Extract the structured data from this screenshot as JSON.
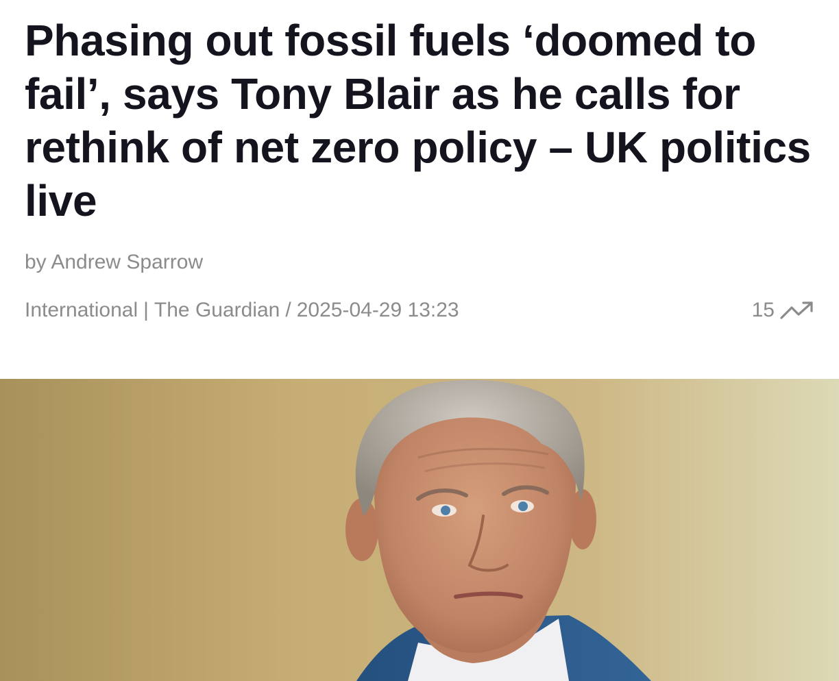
{
  "article": {
    "headline": "Phasing out fossil fuels ‘doomed to fail’, says Tony Blair as he calls for rethink of net zero policy – UK politics live",
    "byline": "by Andrew Sparrow",
    "section": "International",
    "separator": "|",
    "source": "The Guardian",
    "slash": "/",
    "timestamp": "2025-04-29 13:23",
    "trend_count": "15",
    "trend_icon": "trending-up-icon"
  },
  "hero_image": {
    "description_icon": "portrait-photo",
    "colors": {
      "background_left": "#a88f55",
      "background_mid": "#c9b27a",
      "background_right": "#d9d6b2",
      "skin": "#c48a68",
      "hair": "#b9b3aa",
      "jacket": "#2c5a8a",
      "shirt": "#f2f2f4"
    }
  },
  "colors": {
    "headline": "#14141f",
    "meta": "#8b8b8b",
    "background": "#ffffff"
  }
}
